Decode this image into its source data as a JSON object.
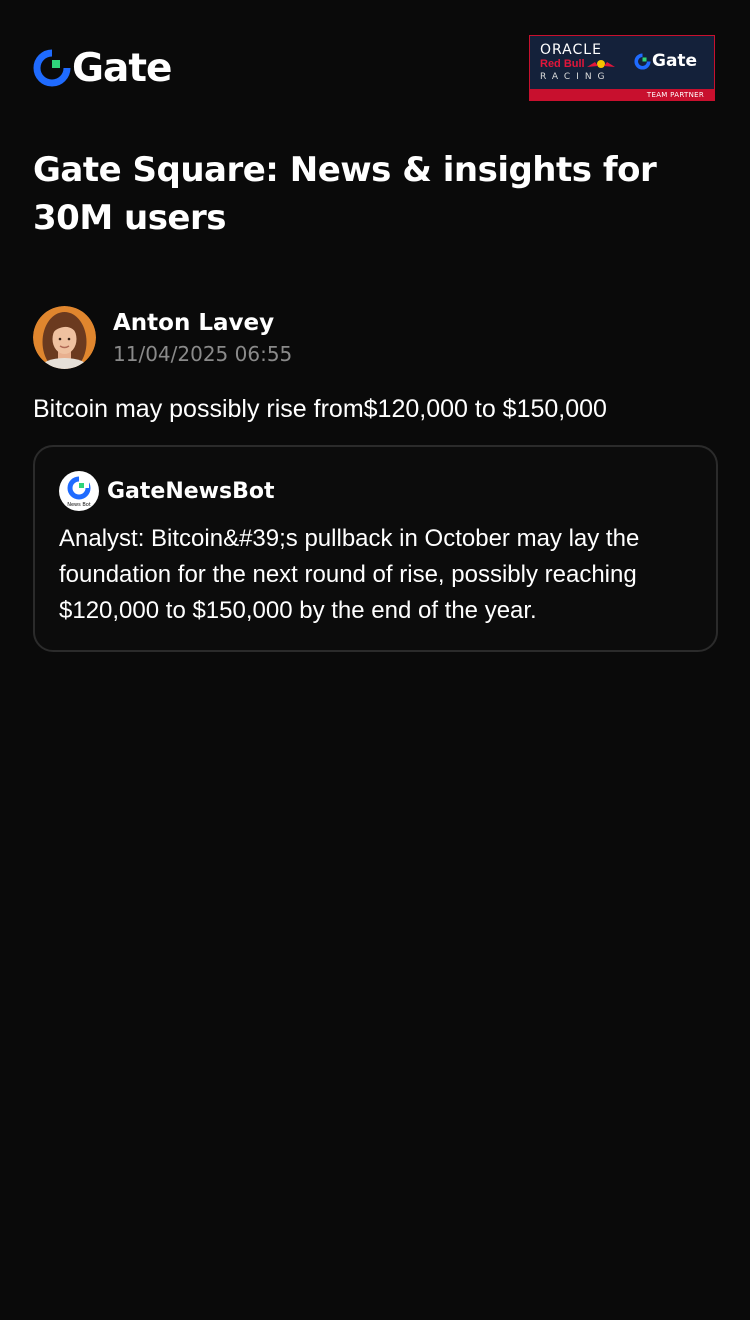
{
  "header": {
    "brand_name": "Gate",
    "partner_banner": {
      "oracle": "ORACLE",
      "red_bull": "Red Bull",
      "racing": "RACING",
      "gate": "Gate",
      "tag": "TEAM PARTNER"
    }
  },
  "page_title": "Gate Square: News & insights for 30M users",
  "post": {
    "author_name": "Anton Lavey",
    "timestamp": "11/04/2025 06:55",
    "text": "Bitcoin may possibly rise from$120,000 to $150,000",
    "quote": {
      "bot_name": "GateNewsBot",
      "bot_avatar_caption": "News Bot",
      "text": "Analyst: Bitcoin&#39;s pullback in October may lay the foundation for the next round of rise, possibly reaching $120,000 to $150,000 by the end of the year."
    }
  },
  "colors": {
    "background": "#0a0a0a",
    "brand_blue": "#1f6bff",
    "brand_green": "#2fd47a",
    "muted_text": "#8a8a8a",
    "card_border": "#2b2b2b",
    "banner_navy": "#14213a",
    "banner_red": "#c8102e"
  },
  "icons": {
    "brand": "gate-logo-icon",
    "avatar": "user-avatar",
    "bot": "gate-news-bot-icon"
  }
}
